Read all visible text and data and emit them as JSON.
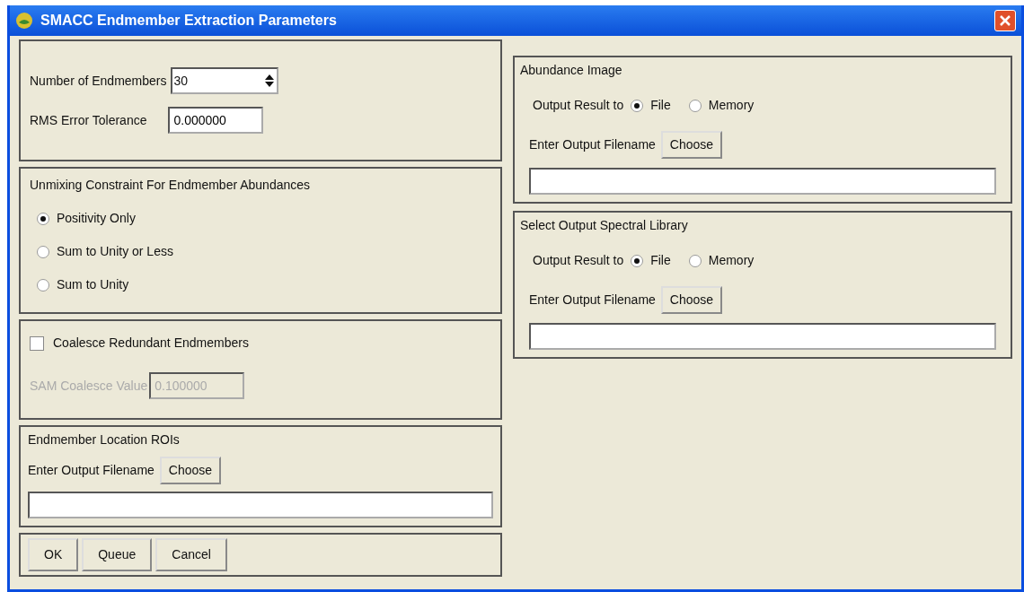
{
  "window": {
    "title": "SMACC Endmember Extraction Parameters"
  },
  "parameters": {
    "endmembers": {
      "label": "Number of Endmembers",
      "value": "30"
    },
    "tolerance": {
      "label": "RMS Error Tolerance",
      "value": "0.000000"
    }
  },
  "constraint": {
    "title": "Unmixing Constraint For Endmember Abundances",
    "options": [
      {
        "label": "Positivity Only",
        "selected": true
      },
      {
        "label": "Sum to Unity or Less",
        "selected": false
      },
      {
        "label": "Sum to Unity",
        "selected": false
      }
    ]
  },
  "coalesce": {
    "label": "Coalesce Redundant Endmembers",
    "checked": false,
    "sam": {
      "label": "SAM Coalesce Value",
      "value": "0.100000",
      "disabled": true
    }
  },
  "roi": {
    "title": "Endmember Location ROIs",
    "filename_label": "Enter Output Filename",
    "choose": "Choose"
  },
  "buttons": [
    "OK",
    "Queue",
    "Cancel"
  ],
  "outputs": [
    {
      "title": "Abundance Image",
      "output_label": "Output Result to",
      "options": [
        {
          "label": "File",
          "selected": true
        },
        {
          "label": "Memory",
          "selected": false
        }
      ],
      "filename_label": "Enter Output Filename",
      "choose": "Choose"
    },
    {
      "title": "Select Output Spectral Library",
      "output_label": "Output Result to",
      "options": [
        {
          "label": "File",
          "selected": true
        },
        {
          "label": "Memory",
          "selected": false
        }
      ],
      "filename_label": "Enter Output Filename",
      "choose": "Choose"
    }
  ]
}
